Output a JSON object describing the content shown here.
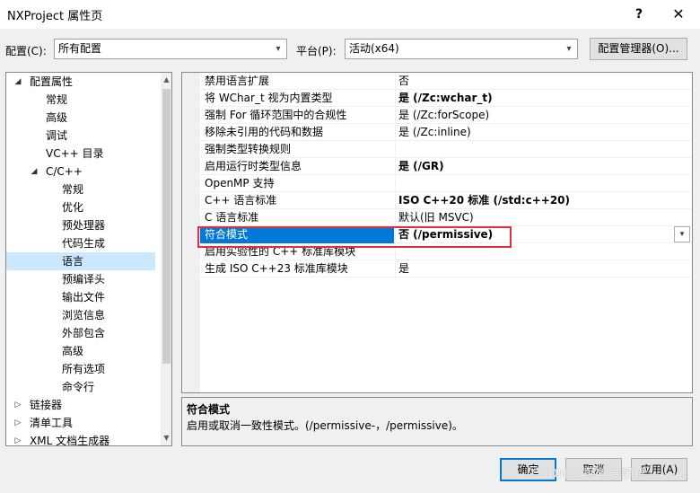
{
  "window": {
    "title": "NXProject 属性页",
    "help_label": "?",
    "close_label": "✕"
  },
  "config_row": {
    "config_label": "配置(C):",
    "config_value": "所有配置",
    "platform_label": "平台(P):",
    "platform_value": "活动(x64)",
    "manager_button": "配置管理器(O)..."
  },
  "tree": {
    "items": [
      {
        "label": "配置属性",
        "expanded": true
      },
      {
        "label": "常规"
      },
      {
        "label": "高级"
      },
      {
        "label": "调试"
      },
      {
        "label": "VC++ 目录"
      },
      {
        "label": "C/C++",
        "expanded": true
      },
      {
        "label": "常规"
      },
      {
        "label": "优化"
      },
      {
        "label": "预处理器"
      },
      {
        "label": "代码生成"
      },
      {
        "label": "语言",
        "selected": true
      },
      {
        "label": "预编译头"
      },
      {
        "label": "输出文件"
      },
      {
        "label": "浏览信息"
      },
      {
        "label": "外部包含"
      },
      {
        "label": "高级"
      },
      {
        "label": "所有选项"
      },
      {
        "label": "命令行"
      },
      {
        "label": "链接器",
        "expanded": false
      },
      {
        "label": "清单工具",
        "expanded": false
      },
      {
        "label": "XML 文档生成器",
        "expanded": false
      }
    ]
  },
  "properties": [
    {
      "name": "禁用语言扩展",
      "value": "否"
    },
    {
      "name": "将 WChar_t 视为内置类型",
      "value": "是 (/Zc:wchar_t)",
      "bold": true
    },
    {
      "name": "强制 For 循环范围中的合规性",
      "value": "是 (/Zc:forScope)"
    },
    {
      "name": "移除未引用的代码和数据",
      "value": "是 (/Zc:inline)"
    },
    {
      "name": "强制类型转换规则",
      "value": ""
    },
    {
      "name": "启用运行时类型信息",
      "value": "是 (/GR)",
      "bold": true
    },
    {
      "name": "OpenMP 支持",
      "value": ""
    },
    {
      "name": "C++ 语言标准",
      "value": "ISO C++20 标准 (/std:c++20)",
      "bold": true
    },
    {
      "name": "C 语言标准",
      "value": "默认(旧 MSVC)"
    },
    {
      "name": "符合模式",
      "value": "否 (/permissive)",
      "bold": true,
      "selected": true
    },
    {
      "name": "启用实验性的 C++ 标准库模块",
      "value": ""
    },
    {
      "name": "生成 ISO C++23 标准库模块",
      "value": "是"
    }
  ],
  "description": {
    "title": "符合模式",
    "text": "启用或取消一致性模式。(/permissive-，/permissive)。"
  },
  "buttons": {
    "ok": "确定",
    "cancel": "取消",
    "apply": "应用(A)"
  },
  "watermark": "CSDN @阿曾爱静谧",
  "colors": {
    "selection": "#0078d7",
    "tree_selection": "#cce8ff",
    "highlight_box": "#e0303c"
  }
}
